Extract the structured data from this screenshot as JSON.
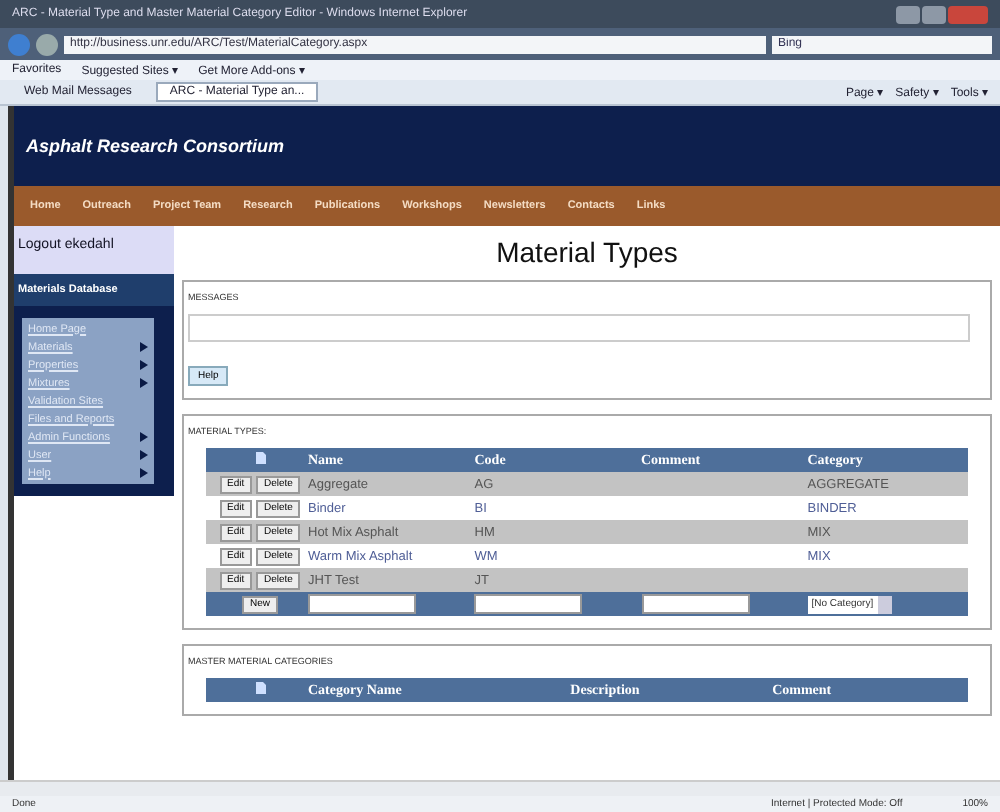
{
  "window": {
    "title": "ARC - Material Type and Master Material Category Editor - Windows Internet Explorer"
  },
  "address_bar": {
    "url": "http://business.unr.edu/ARC/Test/MaterialCategory.aspx",
    "search_placeholder": "Bing"
  },
  "favorites_bar": {
    "items": [
      "Favorites",
      "Suggested Sites ▾",
      "Get More Add-ons ▾"
    ]
  },
  "tabs": [
    {
      "label": "Web Mail Messages",
      "selected": false
    },
    {
      "label": "ARC - Material Type an...",
      "selected": true
    }
  ],
  "command_bar": [
    "Page ▾",
    "Safety ▾",
    "Tools ▾"
  ],
  "site": {
    "title": "Asphalt Research Consortium",
    "nav": [
      "Home",
      "Outreach",
      "Project Team",
      "Research",
      "Publications",
      "Workshops",
      "Newsletters",
      "Contacts",
      "Links"
    ]
  },
  "sidebar": {
    "logout": "Logout ekedahl",
    "section": "Materials Database",
    "items": [
      {
        "label": "Home Page",
        "submenu": false
      },
      {
        "label": "Materials",
        "submenu": true
      },
      {
        "label": "Properties",
        "submenu": true
      },
      {
        "label": "Mixtures",
        "submenu": true
      },
      {
        "label": "Validation Sites",
        "submenu": false
      },
      {
        "label": "Files and Reports",
        "submenu": false
      },
      {
        "label": "Admin Functions",
        "submenu": true
      },
      {
        "label": "User",
        "submenu": true
      },
      {
        "label": "Help",
        "submenu": true
      }
    ]
  },
  "page_title": "Material Types",
  "messages": {
    "label": "MESSAGES",
    "help_button": "Help"
  },
  "material_types": {
    "label": "MATERIAL TYPES:",
    "columns": [
      "Name",
      "Code",
      "Comment",
      "Category"
    ],
    "rows": [
      {
        "edit_button": "Edit",
        "delete_button": "Delete",
        "name": "Aggregate",
        "code": "AG",
        "category": "AGGREGATE"
      },
      {
        "edit_button": "Edit",
        "delete_button": "Delete",
        "name": "Binder",
        "code": "BI",
        "category": "BINDER"
      },
      {
        "edit_button": "Edit",
        "delete_button": "Delete",
        "name": "Hot Mix Asphalt",
        "code": "HM",
        "category": "MIX"
      },
      {
        "edit_button": "Edit",
        "delete_button": "Delete",
        "name": "Warm Mix Asphalt",
        "code": "WM",
        "category": "MIX"
      },
      {
        "edit_button": "Edit",
        "delete_button": "Delete",
        "name": "JHT Test",
        "code": "JT"
      }
    ],
    "new_button": "New",
    "category_select": "[No Category]"
  },
  "master_categories": {
    "label": "MASTER MATERIAL CATEGORIES",
    "columns": [
      "Category Name",
      "Description",
      "Comment"
    ]
  },
  "status_bar": {
    "text": "Done",
    "zone": "Internet | Protected Mode: Off",
    "zoom": "100%"
  }
}
